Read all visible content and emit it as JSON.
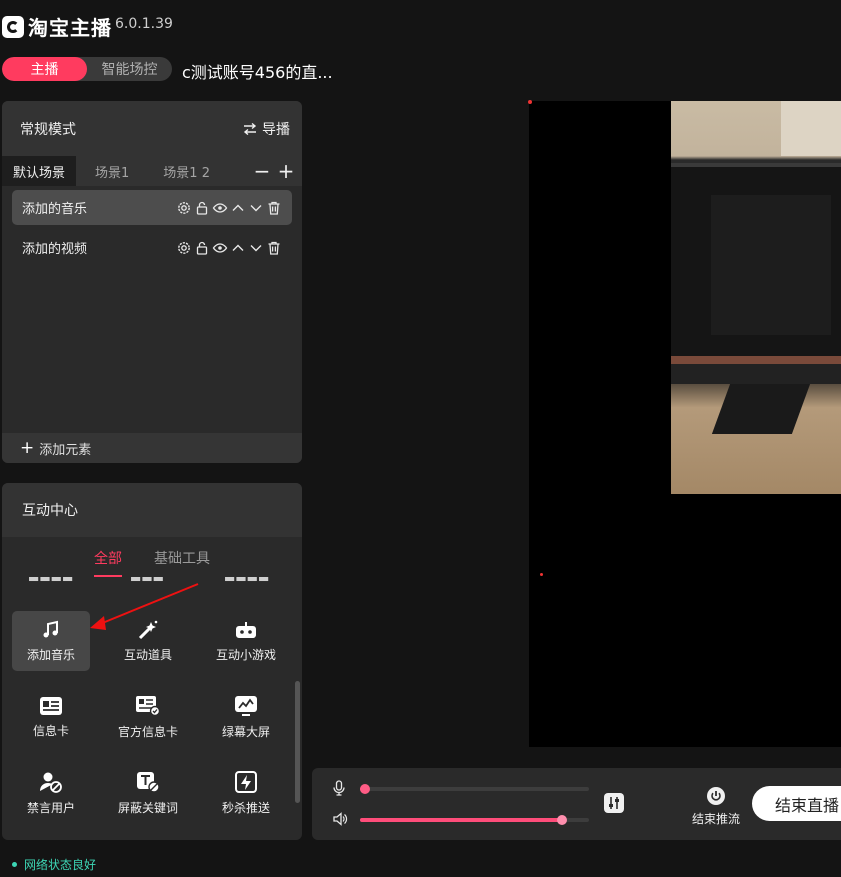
{
  "app": {
    "name": "淘宝主播",
    "version": "6.0.1.39"
  },
  "mode_toggle": {
    "anchor": "主播",
    "smart_control": "智能场控"
  },
  "room_title": "c测试账号456的直...",
  "scene_panel": {
    "title": "常规模式",
    "guide_label": "导播",
    "tabs": [
      "默认场景",
      "场景1",
      "场景1 2"
    ],
    "elements": [
      "添加的音乐",
      "添加的视频"
    ],
    "add_element_label": "添加元素"
  },
  "interaction_center": {
    "title": "互动中心",
    "tabs": [
      "全部",
      "基础工具"
    ],
    "tools": [
      {
        "label": "添加音乐",
        "icon": "music-note-icon"
      },
      {
        "label": "互动道具",
        "icon": "magic-wand-icon"
      },
      {
        "label": "互动小游戏",
        "icon": "gamepad-icon"
      },
      {
        "label": "信息卡",
        "icon": "info-card-icon"
      },
      {
        "label": "官方信息卡",
        "icon": "official-card-icon"
      },
      {
        "label": "绿幕大屏",
        "icon": "green-screen-icon"
      },
      {
        "label": "禁言用户",
        "icon": "mute-user-icon"
      },
      {
        "label": "屏蔽关键词",
        "icon": "block-keyword-icon"
      },
      {
        "label": "秒杀推送",
        "icon": "flash-sale-icon"
      }
    ]
  },
  "audio": {
    "mic_level": 0.02,
    "speaker_level": 0.88
  },
  "controls": {
    "end_stream_label": "结束推流",
    "end_live_label": "结束直播"
  },
  "network_status": "网络状态良好",
  "colors": {
    "accent": "#ff3b5f",
    "status_ok": "#3dd6b5",
    "panel": "#2a2a2a"
  }
}
